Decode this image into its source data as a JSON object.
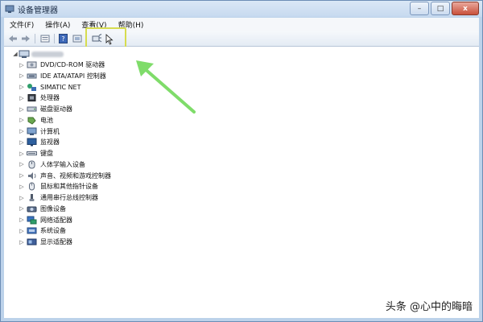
{
  "window": {
    "title": "设备管理器",
    "controls": {
      "minimize": "–",
      "maximize": "□",
      "close": "x"
    }
  },
  "menu": [
    "文件(F)",
    "操作(A)",
    "查看(V)",
    "帮助(H)"
  ],
  "toolbar": {
    "buttons": [
      "back-icon",
      "forward-icon",
      "properties-icon",
      "help-icon",
      "device-icon",
      "scan-hardware-icon"
    ]
  },
  "tree": {
    "root_label": "",
    "items": [
      {
        "label": "DVD/CD-ROM 驱动器",
        "icon": "dvd-drive-icon"
      },
      {
        "label": "IDE ATA/ATAPI 控制器",
        "icon": "ide-controller-icon"
      },
      {
        "label": "SIMATIC NET",
        "icon": "network-node-icon"
      },
      {
        "label": "处理器",
        "icon": "processor-icon"
      },
      {
        "label": "磁盘驱动器",
        "icon": "disk-drive-icon"
      },
      {
        "label": "电池",
        "icon": "battery-icon"
      },
      {
        "label": "计算机",
        "icon": "computer-icon"
      },
      {
        "label": "监视器",
        "icon": "monitor-icon"
      },
      {
        "label": "键盘",
        "icon": "keyboard-icon"
      },
      {
        "label": "人体学输入设备",
        "icon": "hid-icon"
      },
      {
        "label": "声音、视频和游戏控制器",
        "icon": "sound-icon"
      },
      {
        "label": "鼠标和其他指针设备",
        "icon": "mouse-icon"
      },
      {
        "label": "通用串行总线控制器",
        "icon": "usb-icon"
      },
      {
        "label": "图像设备",
        "icon": "camera-icon"
      },
      {
        "label": "网络适配器",
        "icon": "network-adapter-icon"
      },
      {
        "label": "系统设备",
        "icon": "system-device-icon"
      },
      {
        "label": "显示适配器",
        "icon": "display-adapter-icon"
      }
    ]
  },
  "watermark": "头条 @心中的晦暗",
  "colors": {
    "highlight_box": "#d6dc4f",
    "arrow": "#7fdc6a",
    "title_bar": "#c6d9ef",
    "close_button": "#c9503b"
  }
}
